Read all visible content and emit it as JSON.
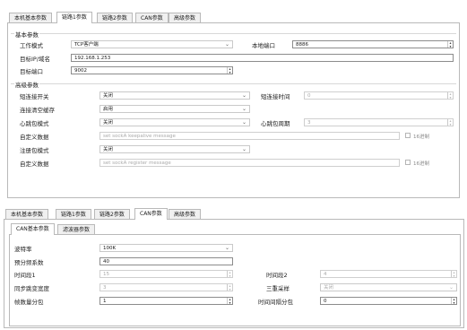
{
  "top": {
    "tabs": [
      "本机基本参数",
      "链路1参数",
      "链路2参数",
      "CAN参数",
      "高级参数"
    ],
    "active_tab": 1,
    "basic_group": "基本参数",
    "work_mode_label": "工作模式",
    "work_mode_value": "TCP客户端",
    "local_port_label": "本地端口",
    "local_port_value": "8886",
    "target_ip_label": "目标IP/域名",
    "target_ip_value": "192.168.1.253",
    "target_port_label": "目标端口",
    "target_port_value": "9002",
    "advanced_group": "高级参数",
    "short_conn_label": "短连接开关",
    "short_conn_value": "关闭",
    "short_conn_time_label": "短连接时间",
    "short_conn_time_value": "0",
    "clear_cache_label": "连接清空缓存",
    "clear_cache_value": "启用",
    "heartbeat_mode_label": "心跳包模式",
    "heartbeat_mode_value": "关闭",
    "heartbeat_period_label": "心跳包周期",
    "heartbeat_period_value": "3",
    "custom_data_label": "自定义数据",
    "custom_heartbeat_placeholder": "set sockA keepalive message",
    "hex_label": "16进制",
    "register_mode_label": "注册包模式",
    "register_mode_value": "关闭",
    "custom_register_label": "自定义数据",
    "custom_register_placeholder": "set sockA register message",
    "hex_label_2": "16进制"
  },
  "bottom": {
    "tabs": [
      "本机基本参数",
      "链路1参数",
      "链路2参数",
      "CAN参数",
      "高级参数"
    ],
    "active_tab": 3,
    "sub_tabs": [
      "CAN基本参数",
      "滤波器参数"
    ],
    "active_sub_tab": 0,
    "baud_label": "波特率",
    "baud_value": "100K",
    "prescaler_label": "预分频系数",
    "prescaler_value": "40",
    "seg1_label": "时间段1",
    "seg1_value": "15",
    "seg2_label": "时间段2",
    "seg2_value": "4",
    "sjw_label": "同步跳变宽度",
    "sjw_value": "3",
    "triple_label": "三重采样",
    "triple_value": "关闭",
    "frame_pack_label": "帧数量分包",
    "frame_pack_value": "1",
    "time_pack_label": "时间间隔分包",
    "time_pack_value": "0"
  }
}
